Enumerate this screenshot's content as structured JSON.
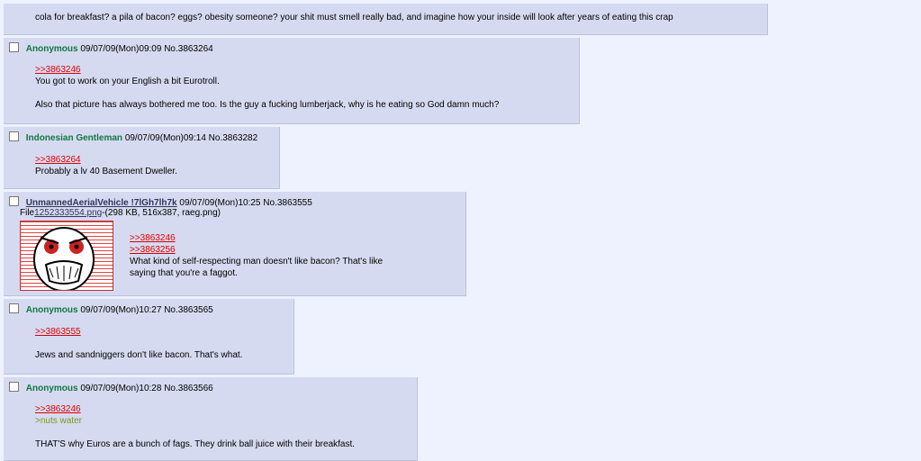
{
  "posts": [
    {
      "lines": [
        "cola for breakfast? a pila of bacon? eggs? obesity someone? your shit must smell really bad, and imagine how your inside will look after years of eating this crap"
      ]
    },
    {
      "name": "Anonymous",
      "datetime": "09/07/09(Mon)09:09",
      "no": "No.3863264",
      "quote": ">>3863246",
      "lines": [
        "You got to work on your English a bit Eurotroll.",
        "Also that picture has always bothered me too. Is the guy a fucking lumberjack, why is he eating so God damn much?"
      ]
    },
    {
      "name": "Indonesian Gentleman",
      "datetime": "09/07/09(Mon)09:14",
      "no": "No.3863282",
      "quote": ">>3863264",
      "lines": [
        "Probably a lv 40 Basement Dweller."
      ]
    },
    {
      "name": "UnmannedAerialVehicle !7lGh7lh7k",
      "datetime": "09/07/09(Mon)10:25",
      "no": "No.3863555",
      "file_prefix": "File",
      "file_link": "1252333554.png",
      "file_meta": "-(298 KB, 516x387, raeg.png)",
      "quotes": [
        ">>3863246",
        ">>3863256"
      ],
      "lines": [
        "What kind of self-respecting man doesn't like bacon? That's like",
        "saying that you're a faggot."
      ]
    },
    {
      "name": "Anonymous",
      "datetime": "09/07/09(Mon)10:27",
      "no": "No.3863565",
      "quote": ">>3863555",
      "lines": [
        "Jews and sandniggers don't like bacon. That's what."
      ]
    },
    {
      "name": "Anonymous",
      "datetime": "09/07/09(Mon)10:28",
      "no": "No.3863566",
      "quote": ">>3863246",
      "greentext": ">nuts water",
      "lines": [
        "THAT'S why Euros are a bunch of fags. They drink ball juice with their breakfast."
      ]
    }
  ],
  "colors": {
    "page_bg": "#EEF2FF",
    "post_bg": "#D6DAF0",
    "name": "#117743",
    "quote_link": "#DD0000",
    "greentext": "#789922"
  },
  "icons": {
    "thumbnail": "rage-face-image"
  }
}
